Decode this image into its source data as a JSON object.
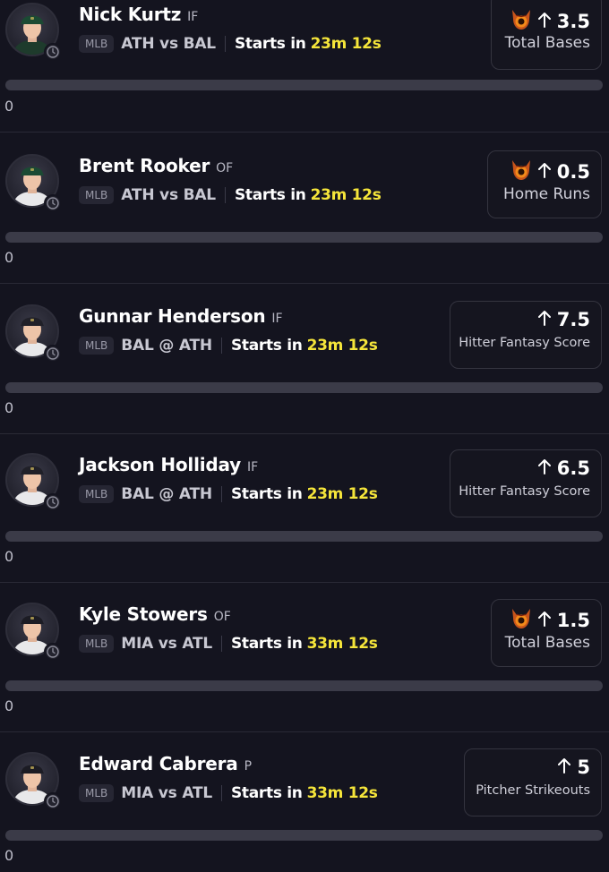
{
  "players": [
    {
      "name": "Nick Kurtz",
      "position": "IF",
      "league": "MLB",
      "matchup": "ATH vs BAL",
      "starts_label": "Starts in",
      "countdown": "23m 12s",
      "line": "3.5",
      "stat": "Total Bases",
      "demon": true,
      "direction_icon": "arrow-up-icon",
      "pick_count": "0",
      "jersey_color": "#1e3b2c",
      "cap_color": "#1b4a33"
    },
    {
      "name": "Brent Rooker",
      "position": "OF",
      "league": "MLB",
      "matchup": "ATH vs BAL",
      "starts_label": "Starts in",
      "countdown": "23m 12s",
      "line": "0.5",
      "stat": "Home Runs",
      "demon": true,
      "direction_icon": "arrow-up-icon",
      "pick_count": "0",
      "jersey_color": "#e8e8ea",
      "cap_color": "#1b4a33"
    },
    {
      "name": "Gunnar Henderson",
      "position": "IF",
      "league": "MLB",
      "matchup": "BAL @ ATH",
      "starts_label": "Starts in",
      "countdown": "23m 12s",
      "line": "7.5",
      "stat": "Hitter Fantasy Score",
      "demon": false,
      "direction_icon": "arrow-up-icon",
      "pick_count": "0",
      "jersey_color": "#e8e8ea",
      "cap_color": "#202028"
    },
    {
      "name": "Jackson Holliday",
      "position": "IF",
      "league": "MLB",
      "matchup": "BAL @ ATH",
      "starts_label": "Starts in",
      "countdown": "23m 12s",
      "line": "6.5",
      "stat": "Hitter Fantasy Score",
      "demon": false,
      "direction_icon": "arrow-up-icon",
      "pick_count": "0",
      "jersey_color": "#e8e8ea",
      "cap_color": "#202028"
    },
    {
      "name": "Kyle Stowers",
      "position": "OF",
      "league": "MLB",
      "matchup": "MIA vs ATL",
      "starts_label": "Starts in",
      "countdown": "33m 12s",
      "line": "1.5",
      "stat": "Total Bases",
      "demon": true,
      "direction_icon": "arrow-up-icon",
      "pick_count": "0",
      "jersey_color": "#e8e8ea",
      "cap_color": "#1c1c24"
    },
    {
      "name": "Edward Cabrera",
      "position": "P",
      "league": "MLB",
      "matchup": "MIA vs ATL",
      "starts_label": "Starts in",
      "countdown": "33m 12s",
      "line": "5",
      "stat": "Pitcher Strikeouts",
      "demon": false,
      "direction_icon": "arrow-up-icon",
      "pick_count": "0",
      "jersey_color": "#e8e8ea",
      "cap_color": "#1c1c24"
    }
  ],
  "colors": {
    "background": "#14141f",
    "countdown": "#f5e53a",
    "progress_track": "#3b3b48",
    "card_border": "#34343f"
  }
}
